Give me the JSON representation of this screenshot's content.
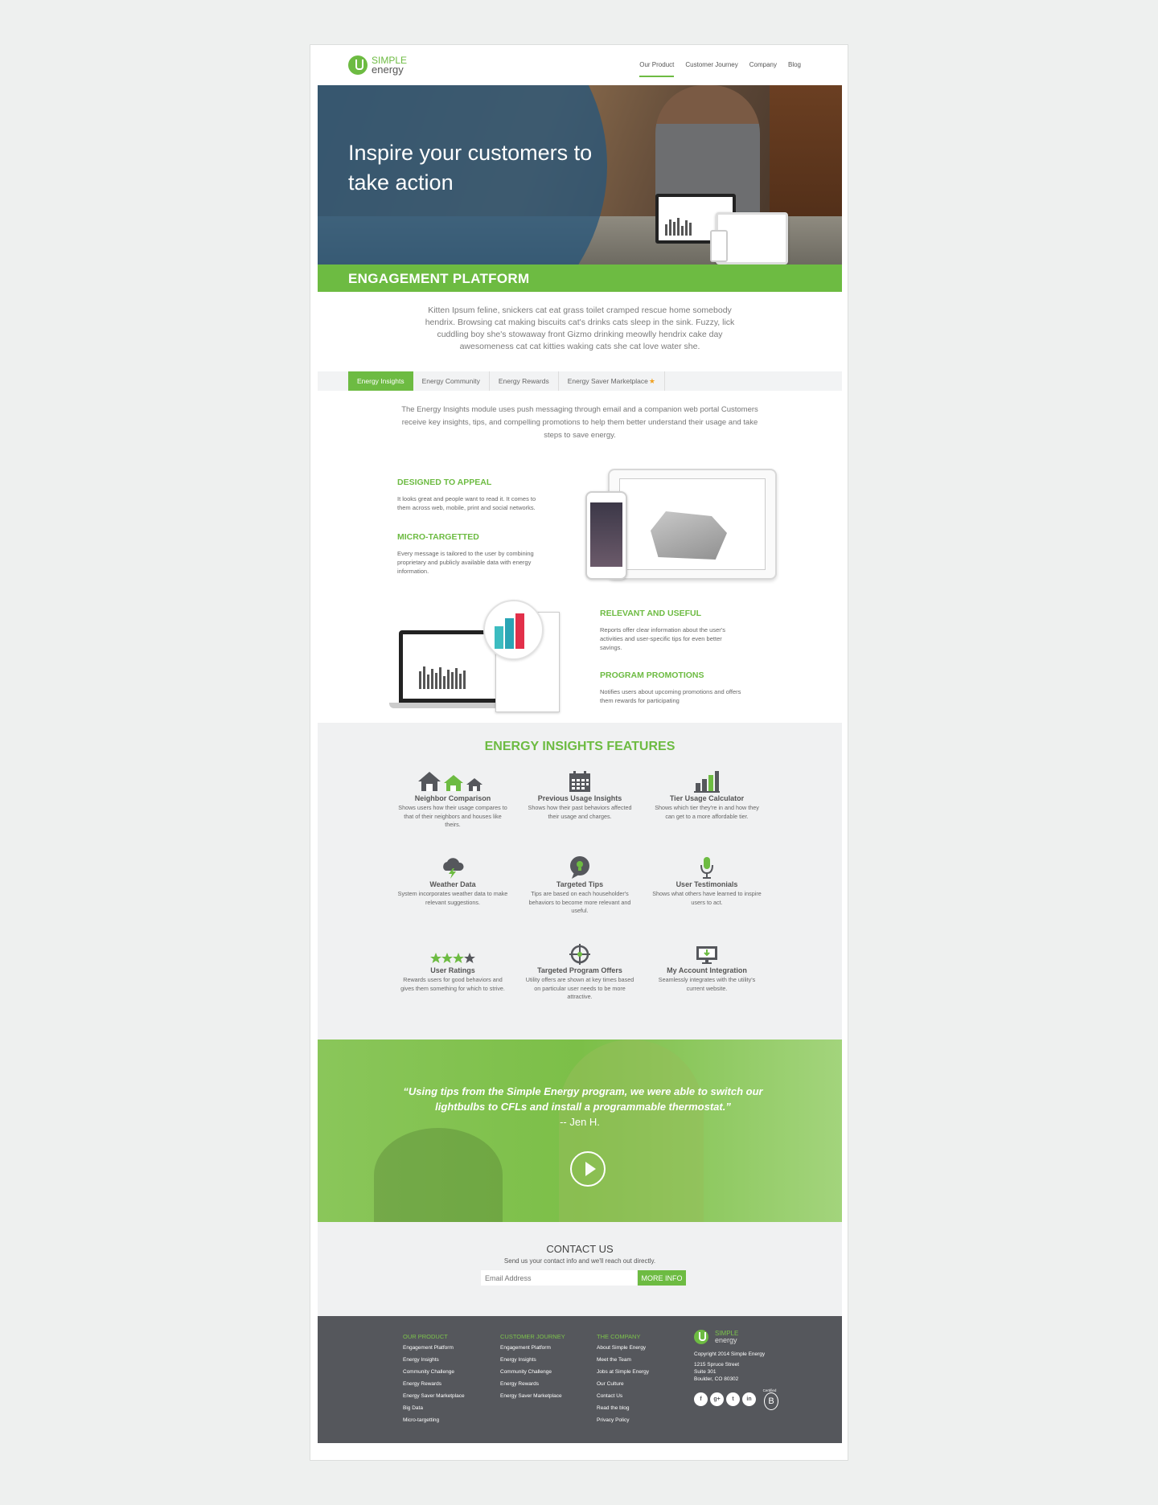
{
  "brand": {
    "name_top": "SIMPLE",
    "name_bottom": "energy",
    "green": "#6dbb42",
    "blue_overlay": "#28567a",
    "footer_gray": "#55575c"
  },
  "nav": {
    "items": [
      {
        "label": "Our Product",
        "active": true
      },
      {
        "label": "Customer Journey"
      },
      {
        "label": "Company"
      },
      {
        "label": "Blog"
      }
    ]
  },
  "hero": {
    "title": "Inspire your customers to take action"
  },
  "band": {
    "title": "ENGAGEMENT PLATFORM"
  },
  "intro": {
    "text": "Kitten Ipsum feline, snickers cat eat grass toilet cramped rescue home somebody hendrix. Browsing cat making biscuits cat's drinks cats sleep in the sink. Fuzzy, lick cuddling boy she's stowaway front Gizmo drinking meowlly hendrix cake day awesomeness cat cat kitties waking cats she cat love water she."
  },
  "tabs": [
    {
      "label": "Energy Insights",
      "active": true
    },
    {
      "label": "Energy Community"
    },
    {
      "label": "Energy Rewards"
    },
    {
      "label": "Energy Saver Marketplace",
      "icon": "star-icon"
    }
  ],
  "module": {
    "description": "The Energy Insights module uses push messaging through email and a companion web portal Customers receive key insights, tips, and compelling promotions to help them better understand their usage and take steps to save energy."
  },
  "highlights": [
    {
      "title": "DESIGNED TO APPEAL",
      "text": "It looks great and people want to read it. It comes to them across web, mobile, print and social networks."
    },
    {
      "title": "MICRO-TARGETTED",
      "text": "Every message is tailored to the user by combining proprietary and publicly available data with energy information."
    },
    {
      "title": "RELEVANT AND USEFUL",
      "text": "Reports offer clear information about the user's activities and user-specific tips for even better savings."
    },
    {
      "title": "PROGRAM PROMOTIONS",
      "text": "Notifies users about upcoming promotions and offers them rewards for participating"
    }
  ],
  "features": {
    "title": "ENERGY INSIGHTS FEATURES",
    "items": [
      {
        "title": "Neighbor Comparison",
        "text": "Shows users how their usage compares to that of their neighbors and houses like theirs.",
        "icon": "houses-icon"
      },
      {
        "title": "Previous Usage Insights",
        "text": "Shows how their past behaviors affected their usage and charges.",
        "icon": "calendar-icon"
      },
      {
        "title": "Tier Usage Calculator",
        "text": "Shows which tier they're in and how they can get to a more affordable tier.",
        "icon": "bar-chart-icon"
      },
      {
        "title": "Weather Data",
        "text": "System incorporates weather data to make relevant suggestions.",
        "icon": "storm-cloud-icon"
      },
      {
        "title": "Targeted Tips",
        "text": "Tips are based on each householder's behaviors to become more relevant and useful.",
        "icon": "lightbulb-bubble-icon"
      },
      {
        "title": "User Testimonials",
        "text": "Shows what others have learned to inspire users to act.",
        "icon": "microphone-icon"
      },
      {
        "title": "User Ratings",
        "text": "Rewards users for good behaviors and gives them something for which to strive.",
        "icon": "stars-icon"
      },
      {
        "title": "Targeted Program Offers",
        "text": "Utility offers are shown at key times based on particular user needs to be more attractive.",
        "icon": "crosshair-icon"
      },
      {
        "title": "My Account Integration",
        "text": "Seamlessly integrates with the utility's current website.",
        "icon": "monitor-icon"
      }
    ]
  },
  "testimonial": {
    "quote": "“Using tips from the Simple Energy program, we were able to switch our lightbulbs to CFLs and install a programmable thermostat.”",
    "author": "-- Jen H."
  },
  "contact": {
    "title": "CONTACT US",
    "subtitle": "Send us your contact info and we'll reach out directly.",
    "email_placeholder": "Email Address",
    "button": "MORE INFO"
  },
  "footer": {
    "columns": [
      {
        "title": "OUR PRODUCT",
        "links": [
          "Engagement Platform",
          "Energy Insights",
          "Community Challenge",
          "Energy Rewards",
          "Energy Saver Marketplace",
          "Big Data",
          "Micro-targetting"
        ]
      },
      {
        "title": "CUSTOMER JOURNEY",
        "links": [
          "Engagement Platform",
          "Energy Insights",
          "Community Challenge",
          "Energy Rewards",
          "Energy Saver Marketplace"
        ]
      },
      {
        "title": "THE COMPANY",
        "links": [
          "About Simple Energy",
          "Meet the Team",
          "Jobs at Simple Energy",
          "Our Culture",
          "Contact Us",
          "Read the blog",
          "Privacy Policy"
        ]
      }
    ],
    "copyright": "Copyright 2014 Simple Energy",
    "address": [
      "1215 Spruce Street",
      "Suite 301",
      "Boulder, CO 80302"
    ],
    "social": [
      "f",
      "g+",
      "t",
      "in"
    ],
    "certified_label": "Certified",
    "bcorp_mark": "B"
  }
}
